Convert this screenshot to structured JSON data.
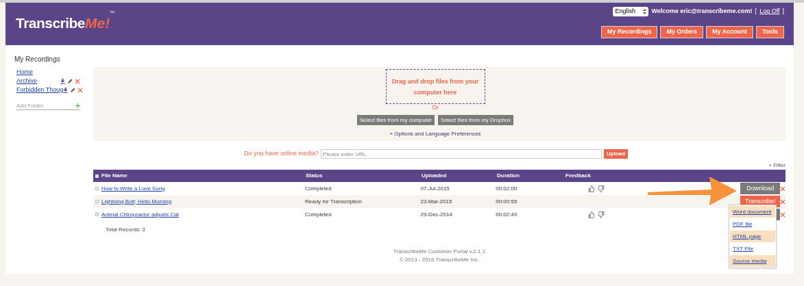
{
  "header": {
    "logo": {
      "main": "Transcribe",
      "accent": "Me!",
      "mark": "™"
    },
    "language": "English",
    "welcome": "Welcome eric@transcribeme.com!",
    "logoff_open": "[",
    "logoff": "Log Off",
    "logoff_close": "]",
    "nav": [
      {
        "label": "My Recordings"
      },
      {
        "label": "My Orders"
      },
      {
        "label": "My Account"
      },
      {
        "label": "Tools"
      }
    ]
  },
  "sidebar": {
    "title": "My Recordings",
    "folders": [
      {
        "label": "Home",
        "editable": false
      },
      {
        "label": "Archive",
        "editable": true
      },
      {
        "label": "Forbidden Thoug",
        "editable": true
      }
    ],
    "add_folder": {
      "placeholder": "Add Folder"
    }
  },
  "upload": {
    "dropzone": "Drag and drop files from your computer here",
    "or": "Or",
    "buttons": [
      "Select files from my computer",
      "Select files from my Dropbox"
    ],
    "options": "+ Options and Language Preferences",
    "online_label": "Do you have online media?",
    "url_placeholder": "Please enter URL",
    "upload_button": "Upload"
  },
  "filter": "+ Filter",
  "table": {
    "columns": [
      "File Name",
      "Status",
      "Uploaded",
      "Duration",
      "Feedback"
    ],
    "rows": [
      {
        "name": "How to Write a Love Song",
        "status": "Completed",
        "uploaded": "07-Jul-2015",
        "duration": "00:02:00",
        "feedback": true,
        "action": {
          "kind": "download",
          "label": "Download"
        },
        "checked": false
      },
      {
        "name": "Lightning Bolt; Hello Morning",
        "status": "Ready for Transcription",
        "uploaded": "23-Mar-2015",
        "duration": "00:00:55",
        "feedback": false,
        "action": {
          "kind": "transcribe",
          "label": "Transcribe!"
        },
        "checked": false
      },
      {
        "name": "Animal Chiropractor adjusts Cat",
        "status": "Completed",
        "uploaded": "29-Dec-2014",
        "duration": "00:02:49",
        "feedback": true,
        "action": {
          "kind": "covered"
        },
        "checked": false
      }
    ],
    "select_all_checked": false,
    "total": "Total Records: 3"
  },
  "download_menu": [
    "Word document",
    "PDF file",
    "HTML page",
    "TXT File",
    "Source media"
  ],
  "footer": [
    "TranscribeMe Customer Portal v.2.1.1",
    "© 2013 - 2016 TranscribeMe Inc."
  ]
}
